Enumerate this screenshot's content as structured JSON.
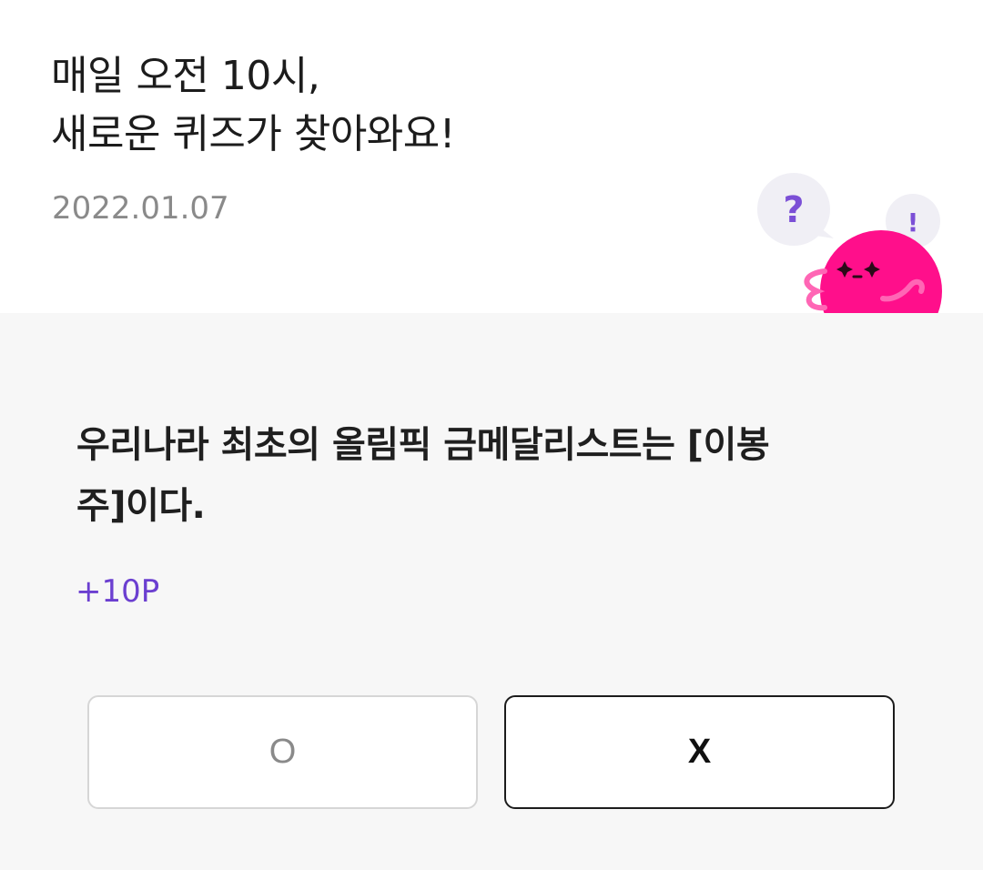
{
  "header": {
    "title_line1": "매일 오전 10시,",
    "title_line2": "새로운 퀴즈가 찾아와요!",
    "date": "2022.01.07"
  },
  "mascot": {
    "bubble_question": "?",
    "bubble_exclaim": "!",
    "colors": {
      "body": "#ff0f8b",
      "bubble": "#f0eff5",
      "bubble_text": "#7b4fd6"
    }
  },
  "quiz": {
    "question_line1": "우리나라 최초의 올림픽 금메달리스트는 [이봉",
    "question_line2": "주]이다.",
    "points": "+10P",
    "options": {
      "o_label": "O",
      "x_label": "X"
    }
  },
  "colors": {
    "accent": "#6b3fd0",
    "quiz_background": "#f7f7f7"
  }
}
